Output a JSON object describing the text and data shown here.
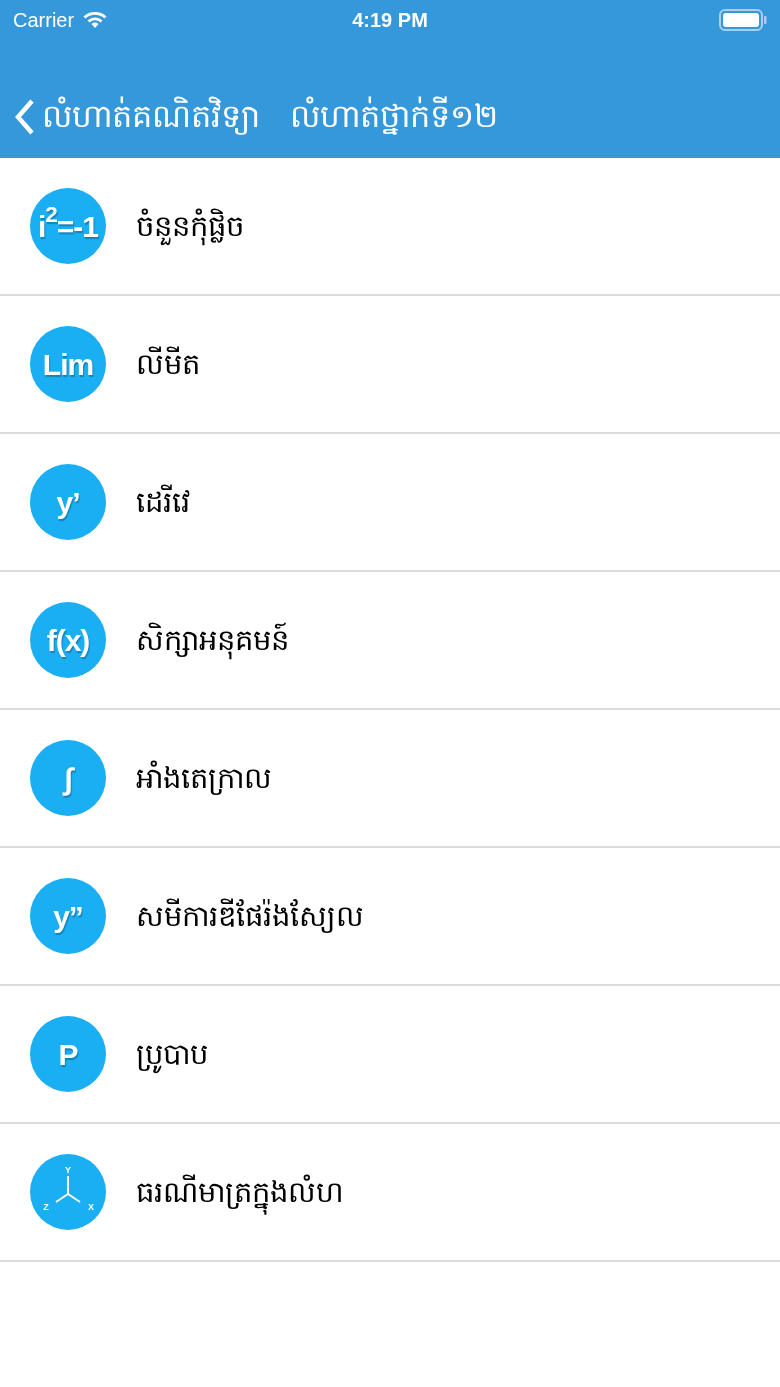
{
  "status_bar": {
    "carrier": "Carrier",
    "time": "4:19 PM"
  },
  "nav": {
    "back_label": "លំហាត់គណិតវិទ្យា",
    "title": "លំហាត់ថ្នាក់ទី១២"
  },
  "items": [
    {
      "kind": "text",
      "icon_text": "i$^{2}$=-1",
      "label": "ចំនួនកុំផ្លិច"
    },
    {
      "kind": "text",
      "icon_text": "Lim",
      "label": "លីមីត"
    },
    {
      "kind": "text",
      "icon_text": "y’",
      "label": "ដេរីវេ"
    },
    {
      "kind": "text",
      "icon_text": "f(x)",
      "label": "សិក្សាអនុគមន៍"
    },
    {
      "kind": "text",
      "icon_text": "∫",
      "label": "អាំងតេក្រាល"
    },
    {
      "kind": "text",
      "icon_text": "y”",
      "label": "សមីការឌីផែរ៉ងស្យែល"
    },
    {
      "kind": "text",
      "icon_text": "P",
      "label": "ប្រូបាប"
    },
    {
      "kind": "axes",
      "axis_labels": [
        "Y",
        "Z",
        "X"
      ],
      "label": "ធរណីមាត្រក្នុងលំហ"
    }
  ]
}
